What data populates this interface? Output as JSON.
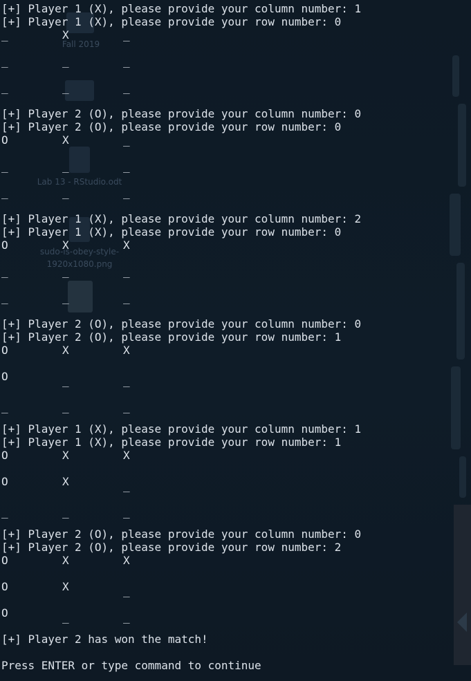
{
  "terminal": {
    "rounds": [
      {
        "col_prompt": "[+] Player 1 (X), please provide your column number: 1",
        "row_prompt": "[+] Player 1 (X), please provide your row number: 0",
        "board": [
          [
            "_",
            "X",
            "_"
          ],
          [
            "_",
            "_",
            "_"
          ],
          [
            "_",
            "_",
            "_"
          ]
        ]
      },
      {
        "col_prompt": "[+] Player 2 (O), please provide your column number: 0",
        "row_prompt": "[+] Player 2 (O), please provide your row number: 0",
        "board": [
          [
            "O",
            "X",
            "_"
          ],
          [
            "_",
            "_",
            "_"
          ],
          [
            "_",
            "_",
            "_"
          ]
        ]
      },
      {
        "col_prompt": "[+] Player 1 (X), please provide your column number: 2",
        "row_prompt": "[+] Player 1 (X), please provide your row number: 0",
        "board": [
          [
            "O",
            "X",
            "X"
          ],
          [
            "_",
            "_",
            "_"
          ],
          [
            "_",
            "_",
            "_"
          ]
        ]
      },
      {
        "col_prompt": "[+] Player 2 (O), please provide your column number: 0",
        "row_prompt": "[+] Player 2 (O), please provide your row number: 1",
        "board": [
          [
            "O",
            "X",
            "X"
          ],
          [
            "O",
            "_",
            "_"
          ],
          [
            "_",
            "_",
            "_"
          ]
        ]
      },
      {
        "col_prompt": "[+] Player 1 (X), please provide your column number: 1",
        "row_prompt": "[+] Player 1 (X), please provide your row number: 1",
        "board": [
          [
            "O",
            "X",
            "X"
          ],
          [
            "O",
            "X",
            "_"
          ],
          [
            "_",
            "_",
            "_"
          ]
        ]
      },
      {
        "col_prompt": "[+] Player 2 (O), please provide your column number: 0",
        "row_prompt": "[+] Player 2 (O), please provide your row number: 2",
        "board": [
          [
            "O",
            "X",
            "X"
          ],
          [
            "O",
            "X",
            "_"
          ],
          [
            "O",
            "_",
            "_"
          ]
        ]
      }
    ],
    "result": "[+] Player 2 has won the match!",
    "prompt": "Press ENTER or type command to continue"
  },
  "desktop": {
    "icon_labels": [
      "Fall 2019",
      "Lab 13 - RStudio.odt",
      "sudo-is-obey-style-",
      "1920x1080.png"
    ]
  },
  "colors": {
    "background": "#0f1b26",
    "foreground": "#dde3ea"
  }
}
